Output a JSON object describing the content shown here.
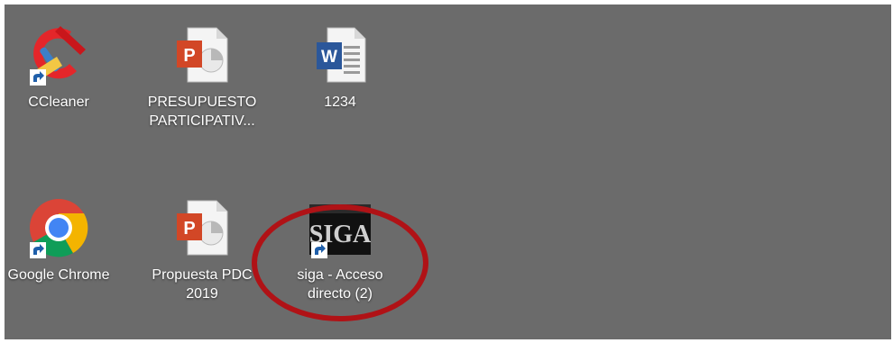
{
  "desktop": {
    "background": "#6b6b6b",
    "icons": [
      {
        "label": "CCleaner",
        "icon": "ccleaner-icon",
        "shortcut": true
      },
      {
        "label": "PRESUPUESTO\nPARTICIPATIV...",
        "icon": "powerpoint-file-icon",
        "shortcut": false
      },
      {
        "label": "1234",
        "icon": "word-document-icon",
        "shortcut": false
      },
      {
        "label": "Google Chrome",
        "icon": "chrome-icon",
        "shortcut": true
      },
      {
        "label": "Propuesta PDC\n2019",
        "icon": "powerpoint-file-icon",
        "shortcut": false
      },
      {
        "label": "siga - Acceso\ndirecto (2)",
        "icon": "siga-icon",
        "shortcut": true
      }
    ]
  },
  "annotation": {
    "color": "#b01216"
  },
  "siga_logo_text": "SIGA"
}
